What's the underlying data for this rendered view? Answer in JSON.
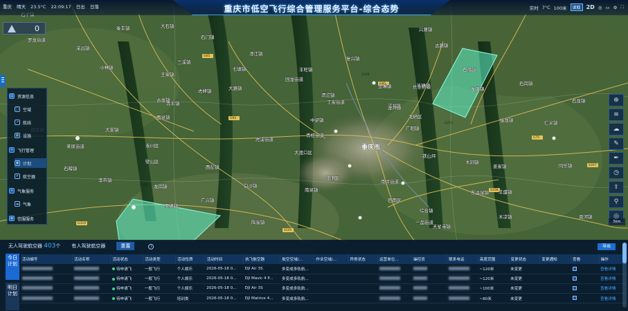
{
  "header": {
    "title": "重庆市低空飞行综合管理服务平台-综合态势",
    "weather": {
      "city": "重庆",
      "condition": "晴天",
      "temp": "23.5°C",
      "time": "22:09:17",
      "sunrise": "日出",
      "sunset": "日落"
    },
    "right": {
      "live": "实时",
      "temp2": "7°C",
      "wind": "100米",
      "mode_badge": "读取",
      "view2d": "2D"
    },
    "icons": [
      "globe-icon",
      "monitor-icon",
      "gear-icon",
      "fullscreen-icon"
    ]
  },
  "alert": {
    "count": "0"
  },
  "menu": {
    "items": [
      {
        "label": "资源信息",
        "icon": "resource-icon",
        "group": true
      },
      {
        "label": "空域",
        "icon": "airspace-icon"
      },
      {
        "label": "航线",
        "icon": "route-icon"
      },
      {
        "label": "设施",
        "icon": "facility-icon"
      },
      {
        "label": "飞行管理",
        "icon": "flight-icon",
        "group": true
      },
      {
        "label": "计划",
        "icon": "plan-icon",
        "active": true
      },
      {
        "label": "航空器",
        "icon": "aircraft-icon"
      },
      {
        "label": "气象服务",
        "icon": "weather-icon",
        "group": true
      },
      {
        "label": "气象",
        "icon": "cloud-icon"
      },
      {
        "label": "信服服务",
        "icon": "service-icon",
        "group": true
      }
    ]
  },
  "map": {
    "labels": [
      {
        "t": "石子镇"
      },
      {
        "t": "泰丰镇"
      },
      {
        "t": "大石镇"
      },
      {
        "t": "罗龙街道"
      },
      {
        "t": "荣昌镇"
      },
      {
        "t": "三溪镇"
      },
      {
        "t": "石门镇"
      },
      {
        "t": "小林镇"
      },
      {
        "t": "七塘镇"
      },
      {
        "t": "丰旺镇"
      },
      {
        "t": "渭沱镇"
      },
      {
        "t": "复兴镇"
      },
      {
        "t": "古路镇"
      },
      {
        "t": "兴隆镇"
      },
      {
        "t": "龙凤镇"
      },
      {
        "t": "王家镇"
      },
      {
        "t": "大路镇"
      },
      {
        "t": "澄江镇"
      },
      {
        "t": "洛碛镇"
      },
      {
        "t": "龙兴镇"
      },
      {
        "t": "石龙镇"
      },
      {
        "t": "青平镇"
      },
      {
        "t": "古龙镇"
      },
      {
        "t": "虎峰镇"
      },
      {
        "t": "回龙街道"
      },
      {
        "t": "鱼嘴镇"
      },
      {
        "t": "石船镇"
      },
      {
        "t": "永川区"
      },
      {
        "t": "双凤镇"
      },
      {
        "t": "来凤街道"
      },
      {
        "t": "大安镇"
      },
      {
        "t": "北碚区"
      },
      {
        "t": "重庆市"
      },
      {
        "t": "西泉镇"
      },
      {
        "t": "壁山区"
      },
      {
        "t": "中梁镇"
      },
      {
        "t": "长生桥镇"
      },
      {
        "t": "广阳镇"
      },
      {
        "t": "江北区"
      },
      {
        "t": "石岗镇"
      },
      {
        "t": "丁家街道"
      },
      {
        "t": "虎溪街道"
      },
      {
        "t": "南坪街道"
      },
      {
        "t": "木洞镇"
      },
      {
        "t": "铁山坪"
      },
      {
        "t": "青杠街道"
      },
      {
        "t": "西彭镇"
      },
      {
        "t": "大渡口区"
      },
      {
        "t": "南泉镇"
      },
      {
        "t": "东温泉镇"
      },
      {
        "t": "白沙镇"
      },
      {
        "t": "李市镇"
      },
      {
        "t": "龙岗镇"
      },
      {
        "t": "陶家镇"
      },
      {
        "t": "天星寺镇"
      },
      {
        "t": "综合镇"
      },
      {
        "t": "一品街道"
      },
      {
        "t": "姜家镇"
      },
      {
        "t": "巴南区"
      },
      {
        "t": "同乐镇"
      },
      {
        "t": "吴滩镇"
      },
      {
        "t": "石蟆镇"
      },
      {
        "t": "广兴镇"
      },
      {
        "t": "江津区"
      },
      {
        "t": "接龙镇"
      },
      {
        "t": "丰盛镇"
      },
      {
        "t": "双河镇"
      },
      {
        "t": "木凉镇"
      },
      {
        "t": "仁义镇"
      }
    ],
    "roads": [
      "G65",
      "G85",
      "G93",
      "G75",
      "S108",
      "S307",
      "G319",
      "S105",
      "S208",
      "S109",
      "G212"
    ],
    "scale": "5km"
  },
  "right_tools": [
    "compass-icon",
    "layers-icon",
    "weather-tool-icon",
    "draw-icon",
    "pen-icon",
    "clock-icon",
    "upload-icon",
    "pin-icon",
    "locate-icon"
  ],
  "bottom": {
    "tabs": [
      {
        "label": "无人驾驶航空器",
        "count": "403",
        "unit": "个"
      },
      {
        "label": "有人驾驶航空器"
      },
      {
        "label": "重置"
      }
    ],
    "export": "导出",
    "side_a": "今日计划",
    "side_b": "明日计划",
    "columns": [
      "活动编号",
      "活动名称",
      "活动状态",
      "活动类型",
      "活动性质",
      "活动时间",
      "执飞航空器",
      "航空空域/...",
      "作业空域/...",
      "异常状态",
      "运营单位...",
      "操控员",
      "联系电话",
      "高度范围",
      "变更状态",
      "变更通知",
      "查看",
      "操作"
    ],
    "rows": [
      {
        "status": "待申请飞",
        "type": "一般飞行",
        "nature": "个人娱乐",
        "time": "2026-05-18 0...",
        "aircraft": "DJI Air 3S",
        "airspace": "多变成多轨航...",
        "height": "~120米",
        "change": "未变更",
        "action": "查看详情"
      },
      {
        "status": "待申请飞",
        "type": "一般飞行",
        "nature": "个人娱乐",
        "time": "2026-05-18 0...",
        "aircraft": "DJI Mavic 4 P...",
        "airspace": "多变成多轨航...",
        "height": "~120米",
        "change": "未变更",
        "action": "查看详情"
      },
      {
        "status": "待申请飞",
        "type": "一般飞行",
        "nature": "个人娱乐",
        "time": "2026-05-18 0...",
        "aircraft": "DJI Air 3S",
        "airspace": "多变成多轨航...",
        "height": "~100米",
        "change": "未变更",
        "action": "查看详情"
      },
      {
        "status": "待申请飞",
        "type": "一般飞行",
        "nature": "培训类",
        "time": "2026-05-18 0...",
        "aircraft": "DJI Matrice 4...",
        "airspace": "多变成多轨航...",
        "height": "~80米",
        "change": "未变更",
        "action": "查看详情"
      }
    ]
  },
  "colors": {
    "accent": "#3fa3ff",
    "polygon": "#5ff0c8",
    "road": "#e6c35a"
  }
}
